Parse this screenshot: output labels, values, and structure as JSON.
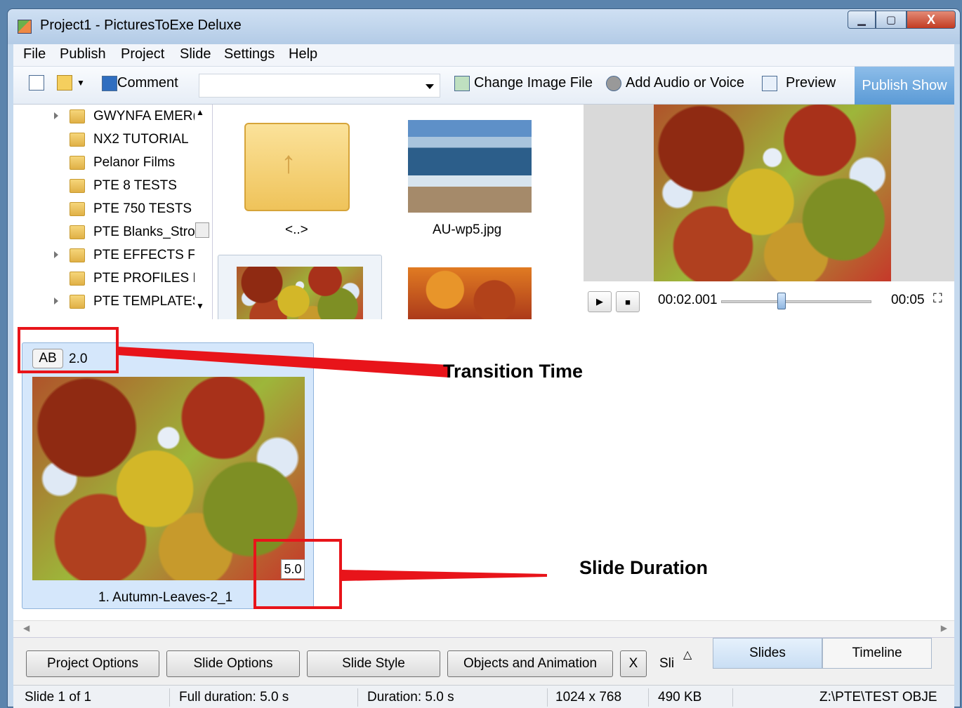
{
  "window": {
    "title": "Project1 - PicturesToExe Deluxe",
    "btn_min": "▁",
    "btn_max": "▢",
    "btn_close": "X"
  },
  "menu": {
    "file": "File",
    "publish": "Publish",
    "project": "Project",
    "slide": "Slide",
    "settings": "Settings",
    "help": "Help"
  },
  "toolbar": {
    "comment": "Comment",
    "change_image": "Change Image File",
    "add_audio": "Add Audio or Voice",
    "preview": "Preview",
    "publish_show": "Publish Show",
    "combo_value": ""
  },
  "tree": {
    "items": [
      "GWYNFA EMER(",
      "NX2 TUTORIAL",
      "Pelanor Films",
      "PTE 8 TESTS",
      "PTE 750 TESTS",
      "PTE Blanks_Strol",
      "PTE EFFECTS FO",
      "PTE PROFILES F(",
      "PTE TEMPLATES"
    ]
  },
  "files": {
    "folder_up": "<..>",
    "file1": "AU-wp5.jpg"
  },
  "player": {
    "time": "00:02.001",
    "total": "00:05",
    "progress": 0.4
  },
  "slide": {
    "transition": "2.0",
    "ab": "AB",
    "duration": "5.0",
    "caption": "1. Autumn-Leaves-2_1"
  },
  "annotations": {
    "transition_time": "Transition Time",
    "slide_duration": "Slide Duration"
  },
  "bottom": {
    "project_options": "Project Options",
    "slide_options": "Slide Options",
    "slide_style": "Slide Style",
    "objects_animation": "Objects and Animation",
    "x": "X",
    "sli": "Sli",
    "tab_slides": "Slides",
    "tab_timeline": "Timeline"
  },
  "status": {
    "slide": "Slide 1 of 1",
    "full_duration": "Full duration: 5.0 s",
    "duration": "Duration: 5.0 s",
    "resolution": "1024 x 768",
    "size": "490 KB",
    "path": "Z:\\PTE\\TEST OBJE"
  }
}
